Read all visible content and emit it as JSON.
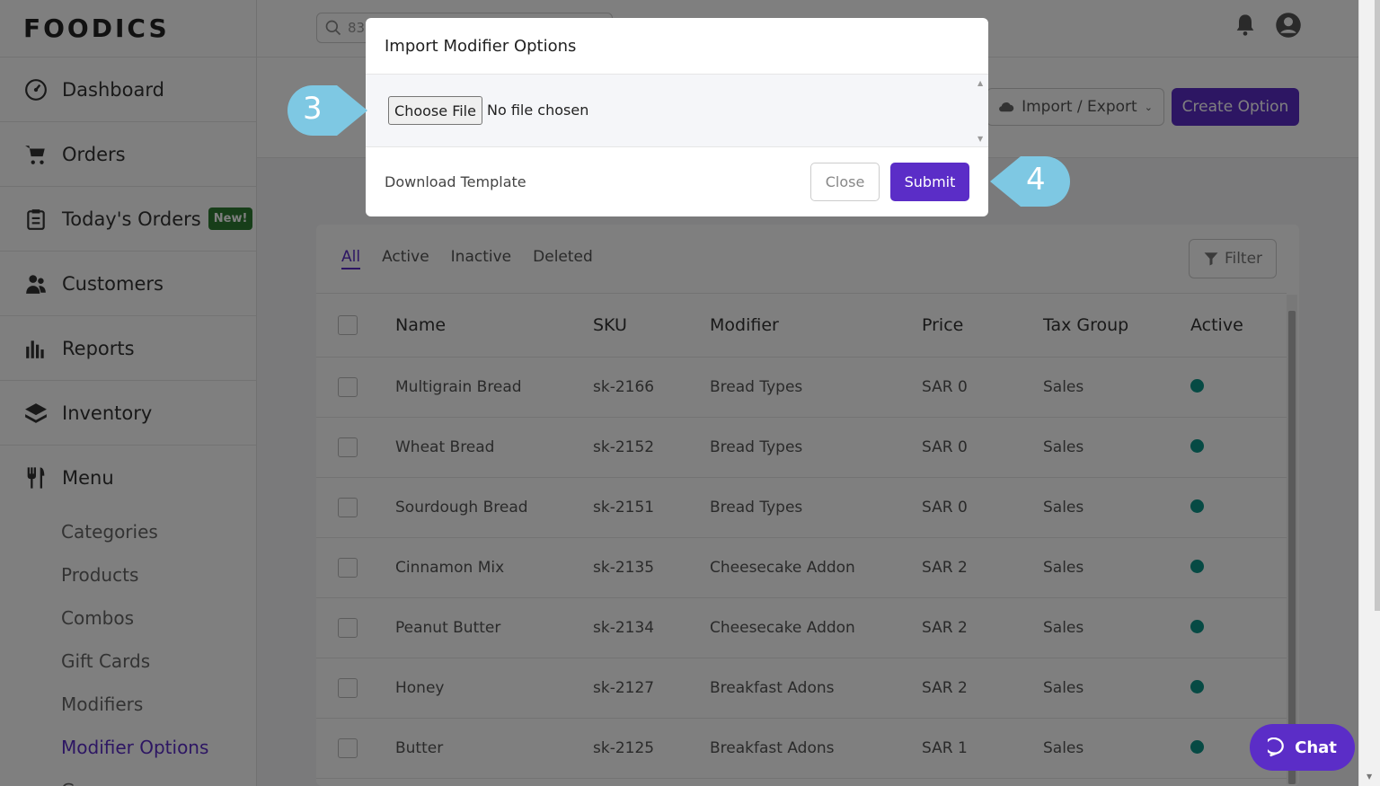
{
  "app": {
    "logo": "FOODICS"
  },
  "sidebar": {
    "items": [
      {
        "label": "Dashboard",
        "icon": "gauge-icon"
      },
      {
        "label": "Orders",
        "icon": "cart-icon"
      },
      {
        "label": "Today's Orders",
        "icon": "clipboard-icon",
        "badge": "New!"
      },
      {
        "label": "Customers",
        "icon": "users-icon"
      },
      {
        "label": "Reports",
        "icon": "bar-chart-icon"
      },
      {
        "label": "Inventory",
        "icon": "layers-icon"
      }
    ],
    "menu": {
      "label": "Menu",
      "icon": "utensils-icon",
      "subitems": [
        "Categories",
        "Products",
        "Combos",
        "Gift Cards",
        "Modifiers",
        "Modifier Options",
        "Groups"
      ],
      "active": "Modifier Options"
    }
  },
  "topbar": {
    "search_value": "83"
  },
  "header": {
    "import_export_label": "Import / Export",
    "create_label": "Create Option"
  },
  "tabs": [
    "All",
    "Active",
    "Inactive",
    "Deleted"
  ],
  "filter_label": "Filter",
  "table": {
    "columns": [
      "Name",
      "SKU",
      "Modifier",
      "Price",
      "Tax Group",
      "Active"
    ],
    "rows": [
      {
        "name": "Multigrain Bread",
        "sku": "sk-2166",
        "modifier": "Bread Types",
        "price": "SAR 0",
        "tax": "Sales"
      },
      {
        "name": "Wheat Bread",
        "sku": "sk-2152",
        "modifier": "Bread Types",
        "price": "SAR 0",
        "tax": "Sales"
      },
      {
        "name": "Sourdough Bread",
        "sku": "sk-2151",
        "modifier": "Bread Types",
        "price": "SAR 0",
        "tax": "Sales"
      },
      {
        "name": "Cinnamon Mix",
        "sku": "sk-2135",
        "modifier": "Cheesecake Addon",
        "price": "SAR 2",
        "tax": "Sales"
      },
      {
        "name": "Peanut Butter",
        "sku": "sk-2134",
        "modifier": "Cheesecake Addon",
        "price": "SAR 2",
        "tax": "Sales"
      },
      {
        "name": "Honey",
        "sku": "sk-2127",
        "modifier": "Breakfast Adons",
        "price": "SAR 2",
        "tax": "Sales"
      },
      {
        "name": "Butter",
        "sku": "sk-2125",
        "modifier": "Breakfast Adons",
        "price": "SAR 1",
        "tax": "Sales"
      }
    ]
  },
  "modal": {
    "title": "Import Modifier Options",
    "choose_file": "Choose File",
    "file_status": "No file chosen",
    "download_template": "Download Template",
    "close": "Close",
    "submit": "Submit"
  },
  "callouts": {
    "step3": "3",
    "step4": "4"
  },
  "chat": {
    "label": "Chat"
  },
  "colors": {
    "brand": "#5b2dc7",
    "active_dot": "#0d9488",
    "new_badge": "#2e7d32",
    "callout": "#7ec8e3"
  }
}
